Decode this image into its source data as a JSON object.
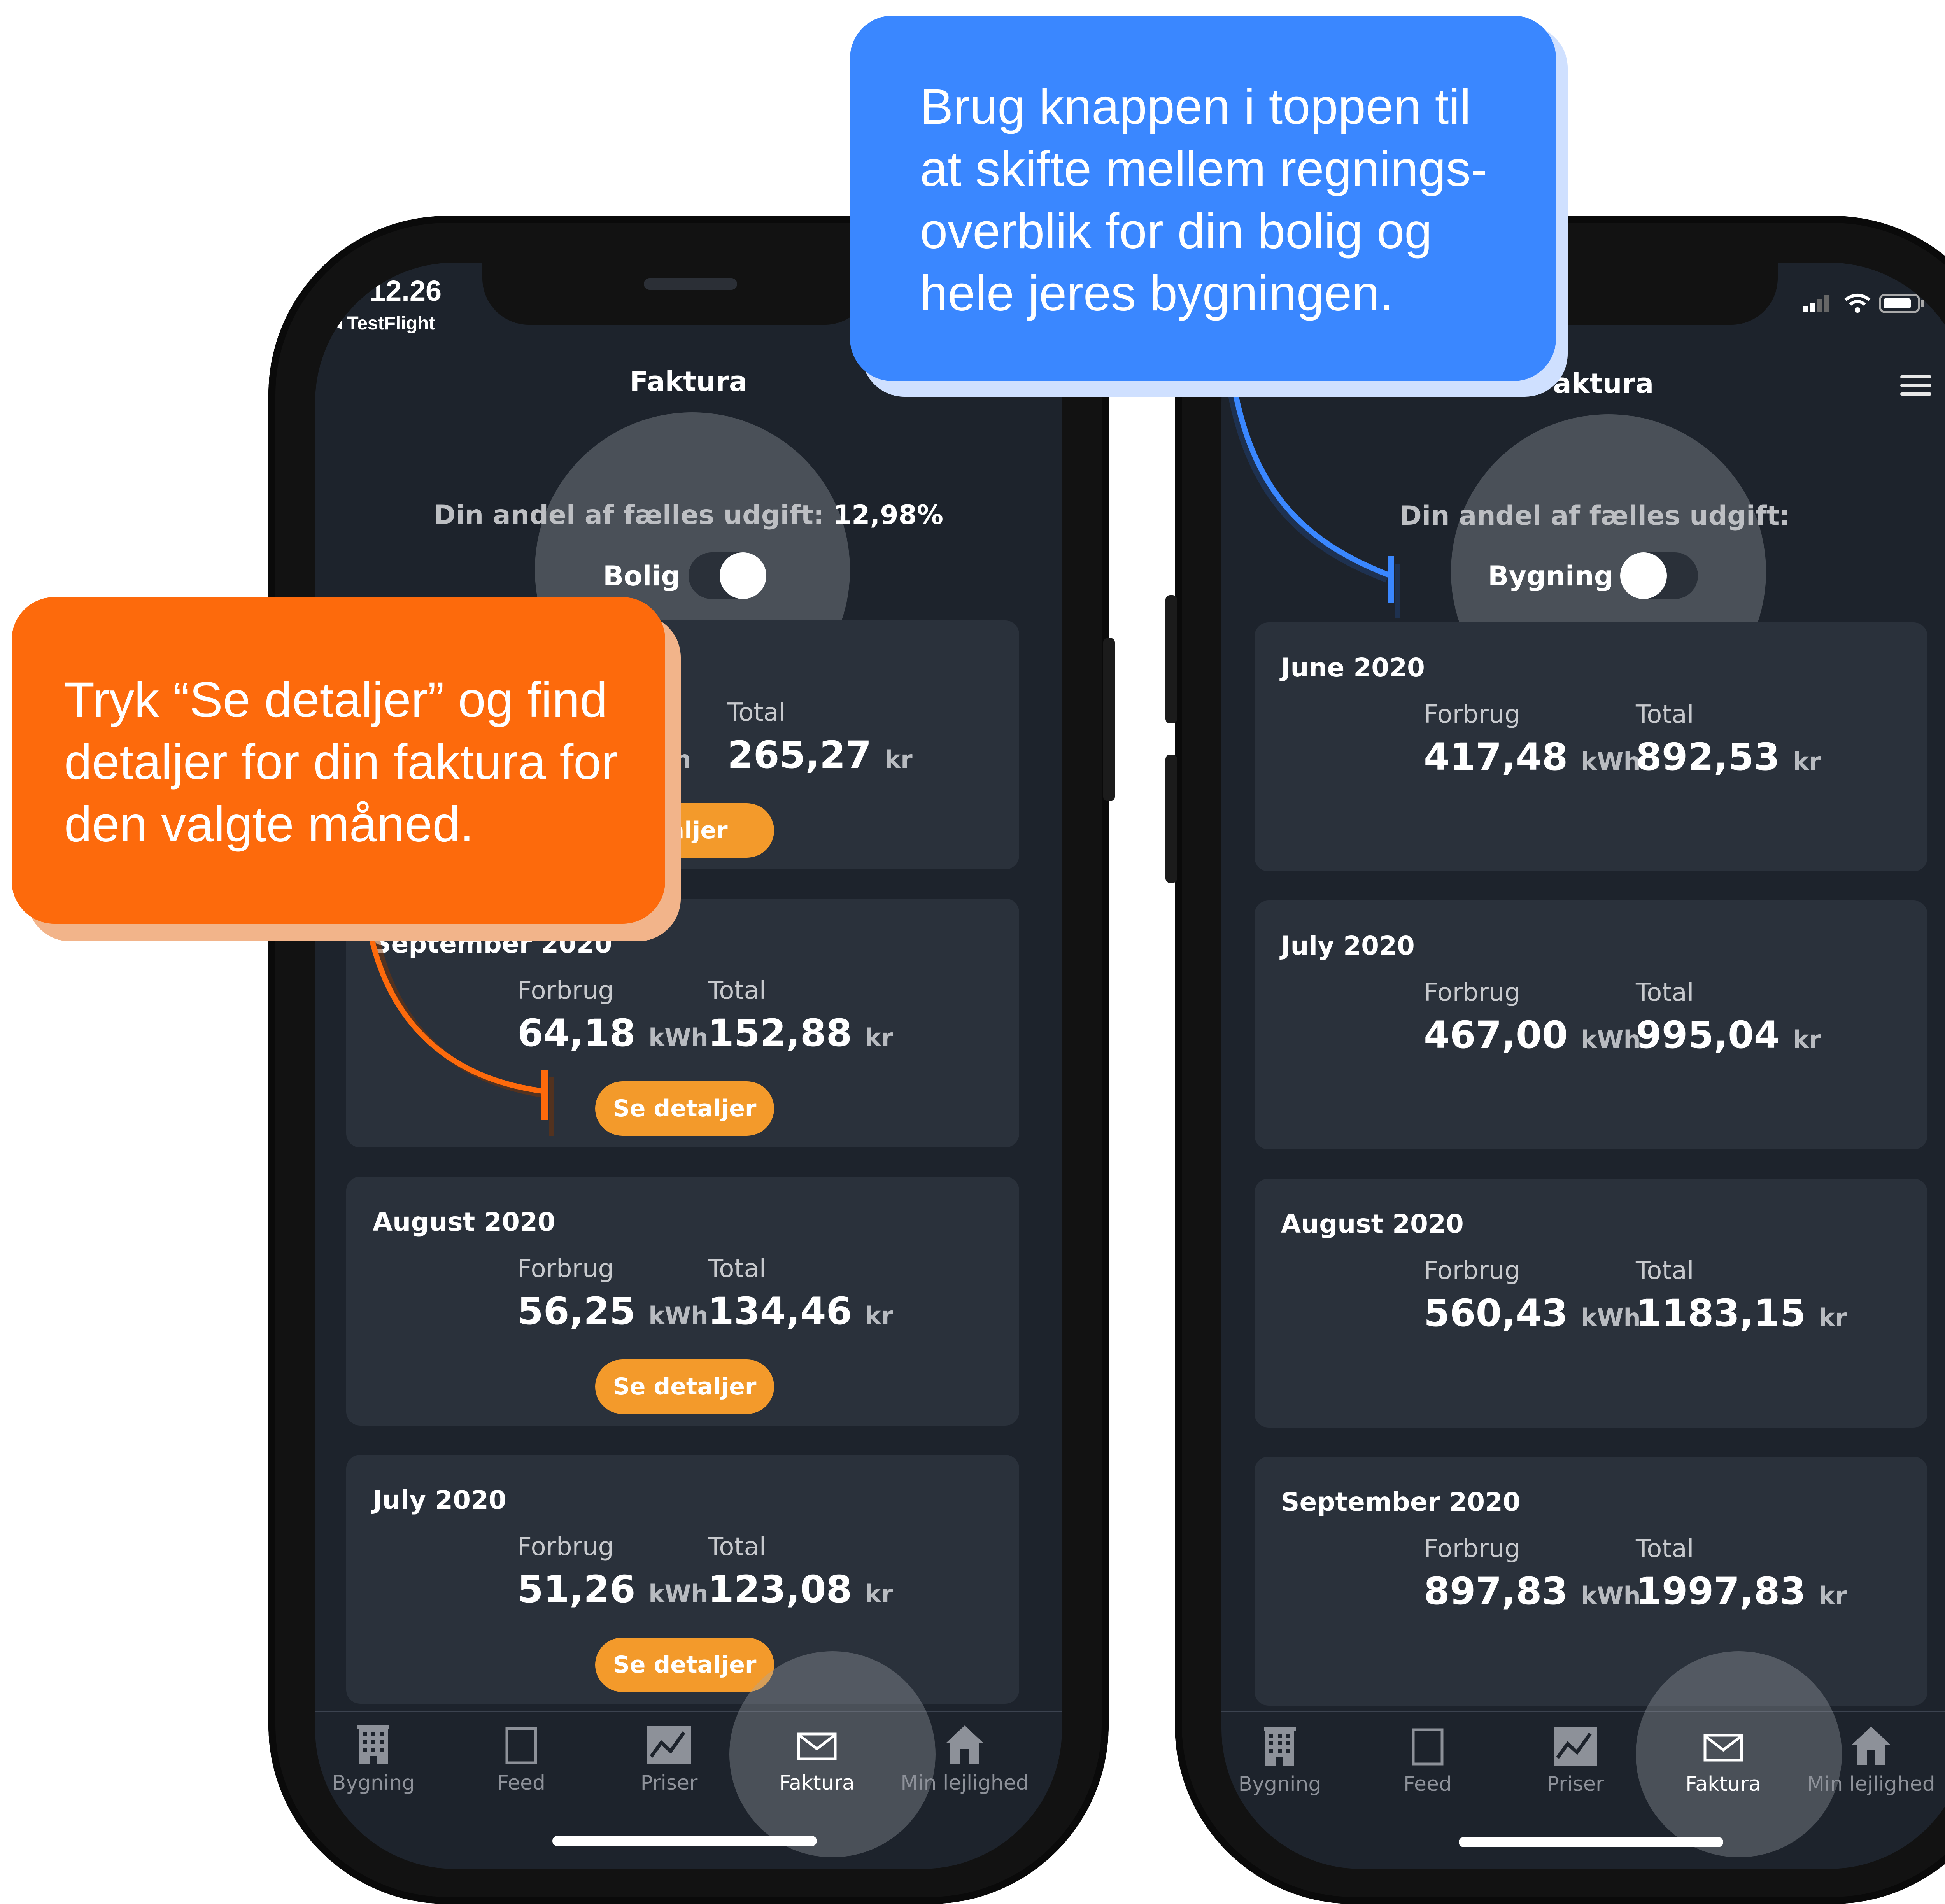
{
  "callouts": {
    "blue": [
      "Brug knappen i toppen til",
      "at skifte mellem regnings-",
      "overblik for din bolig og",
      "hele jeres bygningen."
    ],
    "orange": [
      "Tryk “Se detaljer” og find",
      "detaljer for din faktura for",
      "den valgte måned."
    ]
  },
  "colors": {
    "blue": "#3a87ff",
    "orange": "#fd6a0c",
    "button": "#f39a2b",
    "card": "#2a313b",
    "screen": "#1d232c"
  },
  "left": {
    "status": {
      "time": "12.26",
      "back": "◂ TestFlight"
    },
    "title": "Faktura",
    "share_label": "Din andel af fælles udgift:",
    "share_value": "12,98%",
    "toggle_label": "Bolig",
    "cards": [
      {
        "month": "",
        "forbrug_label": "Forbrug",
        "total_label": "Total",
        "forbrug": "/h",
        "forbrug_unit": "",
        "total": "265,27",
        "total_unit": "kr",
        "button": "etaljer"
      },
      {
        "month": "September 2020",
        "forbrug_label": "Forbrug",
        "total_label": "Total",
        "forbrug": "64,18",
        "forbrug_unit": "kWh",
        "total": "152,88",
        "total_unit": "kr",
        "button": "Se detaljer"
      },
      {
        "month": "August 2020",
        "forbrug_label": "Forbrug",
        "total_label": "Total",
        "forbrug": "56,25",
        "forbrug_unit": "kWh",
        "total": "134,46",
        "total_unit": "kr",
        "button": "Se detaljer"
      },
      {
        "month": "July 2020",
        "forbrug_label": "Forbrug",
        "total_label": "Total",
        "forbrug": "51,26",
        "forbrug_unit": "kWh",
        "total": "123,08",
        "total_unit": "kr",
        "button": "Se detaljer"
      }
    ],
    "tabs": [
      "Bygning",
      "Feed",
      "Priser",
      "Faktura",
      "Min lejlighed"
    ]
  },
  "right": {
    "title": "Faktura",
    "share_label": "Din andel af fælles udgift:",
    "toggle_label": "Bygning",
    "cards": [
      {
        "month": "June 2020",
        "forbrug_label": "Forbrug",
        "total_label": "Total",
        "forbrug": "417,48",
        "forbrug_unit": "kWh",
        "total": "892,53",
        "total_unit": "kr"
      },
      {
        "month": "July 2020",
        "forbrug_label": "Forbrug",
        "total_label": "Total",
        "forbrug": "467,00",
        "forbrug_unit": "kWh",
        "total": "995,04",
        "total_unit": "kr"
      },
      {
        "month": "August 2020",
        "forbrug_label": "Forbrug",
        "total_label": "Total",
        "forbrug": "560,43",
        "forbrug_unit": "kWh",
        "total": "1183,15",
        "total_unit": "kr"
      },
      {
        "month": "September 2020",
        "forbrug_label": "Forbrug",
        "total_label": "Total",
        "forbrug": "897,83",
        "forbrug_unit": "kWh",
        "total": "1997,83",
        "total_unit": "kr"
      }
    ],
    "tabs": [
      "Bygning",
      "Feed",
      "Priser",
      "Faktura",
      "Min lejlighed"
    ]
  }
}
